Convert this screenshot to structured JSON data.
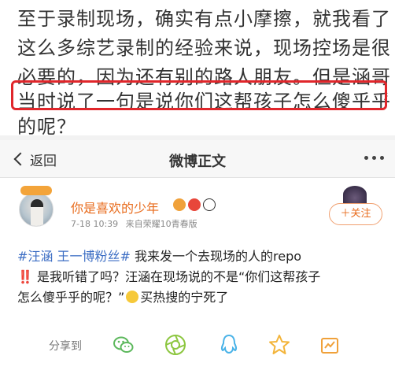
{
  "article": {
    "lines": [
      "至于录制现场，确实有点小摩擦，就我看了",
      "这么多综艺录制的经验来说，现场控场是很",
      "必要的，因为还有别的路人朋友。但是涵哥",
      "当时说了一句是说你们这帮孩子怎么傻乎乎",
      "的呢？"
    ]
  },
  "nav": {
    "back_label": "返回",
    "title": "微博正文"
  },
  "post": {
    "username": "你是喜欢的少年",
    "meta_time": "7-18 10:39",
    "meta_source": "来自荣耀10青春版",
    "follow_label": "＋关注",
    "text": {
      "hashtag": "#汪涵 王一博粉丝#",
      "line1_rest": " 我来发一个去现场的人的repo",
      "excl": "‼️",
      "line2_rest": " 是我听错了吗？汪涵在现场说的不是“你们这帮孩子",
      "line3_a": "怎么傻乎乎的呢？”",
      "line3_b": "买热搜的宁死了"
    }
  },
  "share": {
    "label": "分享到",
    "icons": [
      "wechat-icon",
      "moments-icon",
      "qq-icon",
      "qzone-icon",
      "repost-icon"
    ]
  },
  "colors": {
    "highlight": "#e0262b",
    "username": "#e86b1c",
    "hashtag": "#3d6ec4"
  }
}
